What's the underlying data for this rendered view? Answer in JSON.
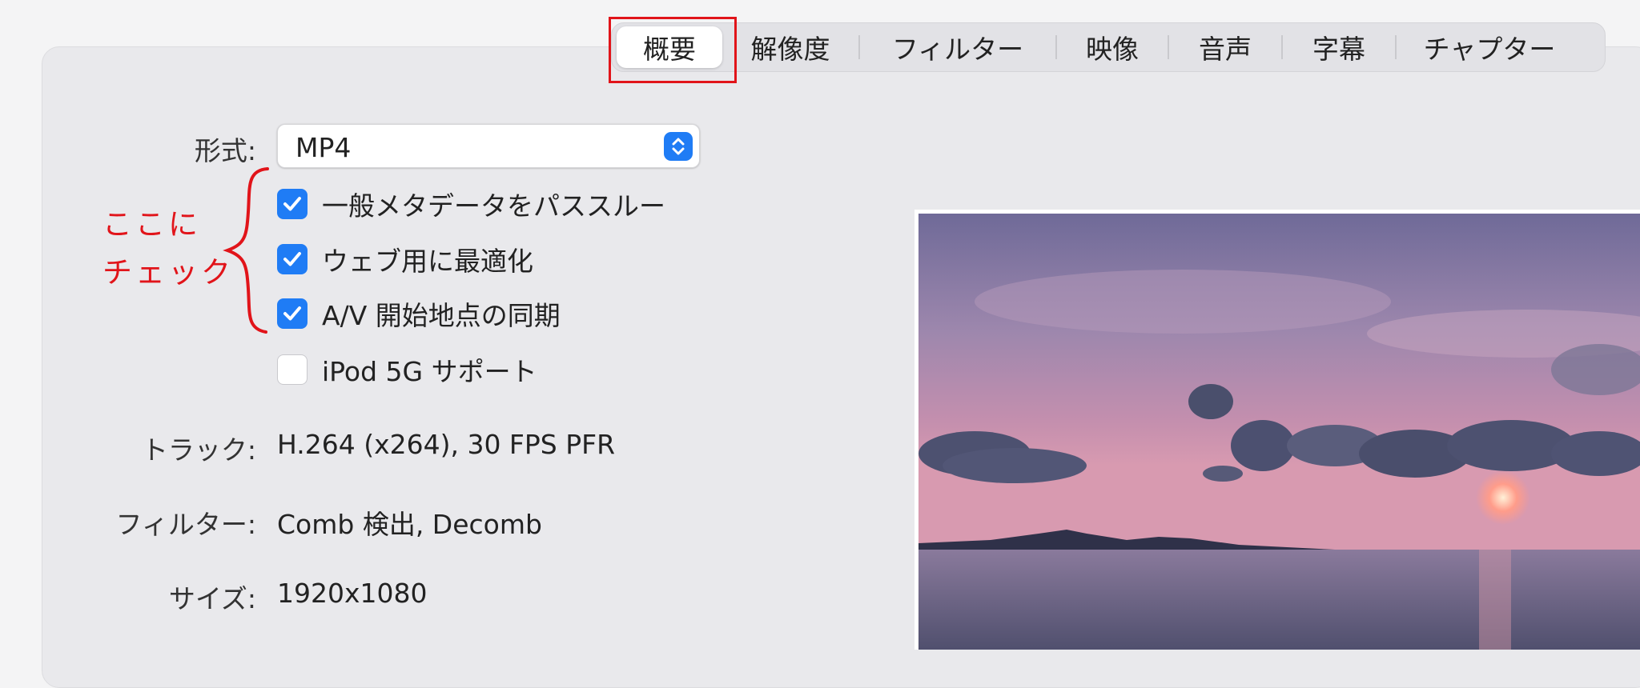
{
  "tabs": [
    {
      "label": "概要",
      "selected": true
    },
    {
      "label": "解像度",
      "selected": false
    },
    {
      "label": "フィルター",
      "selected": false
    },
    {
      "label": "映像",
      "selected": false
    },
    {
      "label": "音声",
      "selected": false
    },
    {
      "label": "字幕",
      "selected": false
    },
    {
      "label": "チャプター",
      "selected": false
    }
  ],
  "summary": {
    "format_label": "形式:",
    "format_value": "MP4",
    "checkboxes": [
      {
        "label": "一般メタデータをパススルー",
        "checked": true
      },
      {
        "label": "ウェブ用に最適化",
        "checked": true
      },
      {
        "label": "A/V 開始地点の同期",
        "checked": true
      },
      {
        "label": "iPod 5G サポート",
        "checked": false
      }
    ],
    "track_label": "トラック:",
    "track_value": "H.264 (x264), 30 FPS PFR",
    "filter_label": "フィルター:",
    "filter_value": "Comb 検出, Decomb",
    "size_label": "サイズ:",
    "size_value": "1920x1080"
  },
  "annotation": {
    "line1": "ここに",
    "line2": "チェック",
    "color": "#e1141a"
  },
  "colors": {
    "accent": "#1f7cf5",
    "highlight": "#e1141a",
    "panel": "#e9e9ec"
  },
  "icons": {
    "select_arrow": "chevron-up-down-icon",
    "checkmark": "checkmark-icon"
  }
}
